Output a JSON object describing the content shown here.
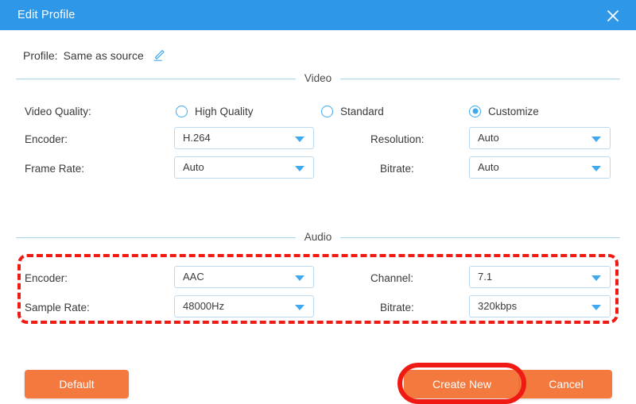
{
  "window": {
    "title": "Edit Profile",
    "close_icon": "close-icon",
    "accent_color": "#2f97e8",
    "button_color": "#f4793f",
    "highlight_color": "#f01a15"
  },
  "profile": {
    "label": "Profile:",
    "value": "Same as source",
    "edit_icon": "pencil-edit-icon"
  },
  "sections": {
    "video": "Video",
    "audio": "Audio"
  },
  "video": {
    "quality_label": "Video Quality:",
    "quality_options": [
      {
        "label": "High Quality",
        "selected": false
      },
      {
        "label": "Standard",
        "selected": false
      },
      {
        "label": "Customize",
        "selected": true
      }
    ],
    "encoder_label": "Encoder:",
    "encoder_value": "H.264",
    "resolution_label": "Resolution:",
    "resolution_value": "Auto",
    "framerate_label": "Frame Rate:",
    "framerate_value": "Auto",
    "bitrate_label": "Bitrate:",
    "bitrate_value": "Auto"
  },
  "audio": {
    "encoder_label": "Encoder:",
    "encoder_value": "AAC",
    "channel_label": "Channel:",
    "channel_value": "7.1",
    "samplerate_label": "Sample Rate:",
    "samplerate_value": "48000Hz",
    "bitrate_label": "Bitrate:",
    "bitrate_value": "320kbps"
  },
  "footer": {
    "default_label": "Default",
    "create_label": "Create New",
    "cancel_label": "Cancel"
  }
}
